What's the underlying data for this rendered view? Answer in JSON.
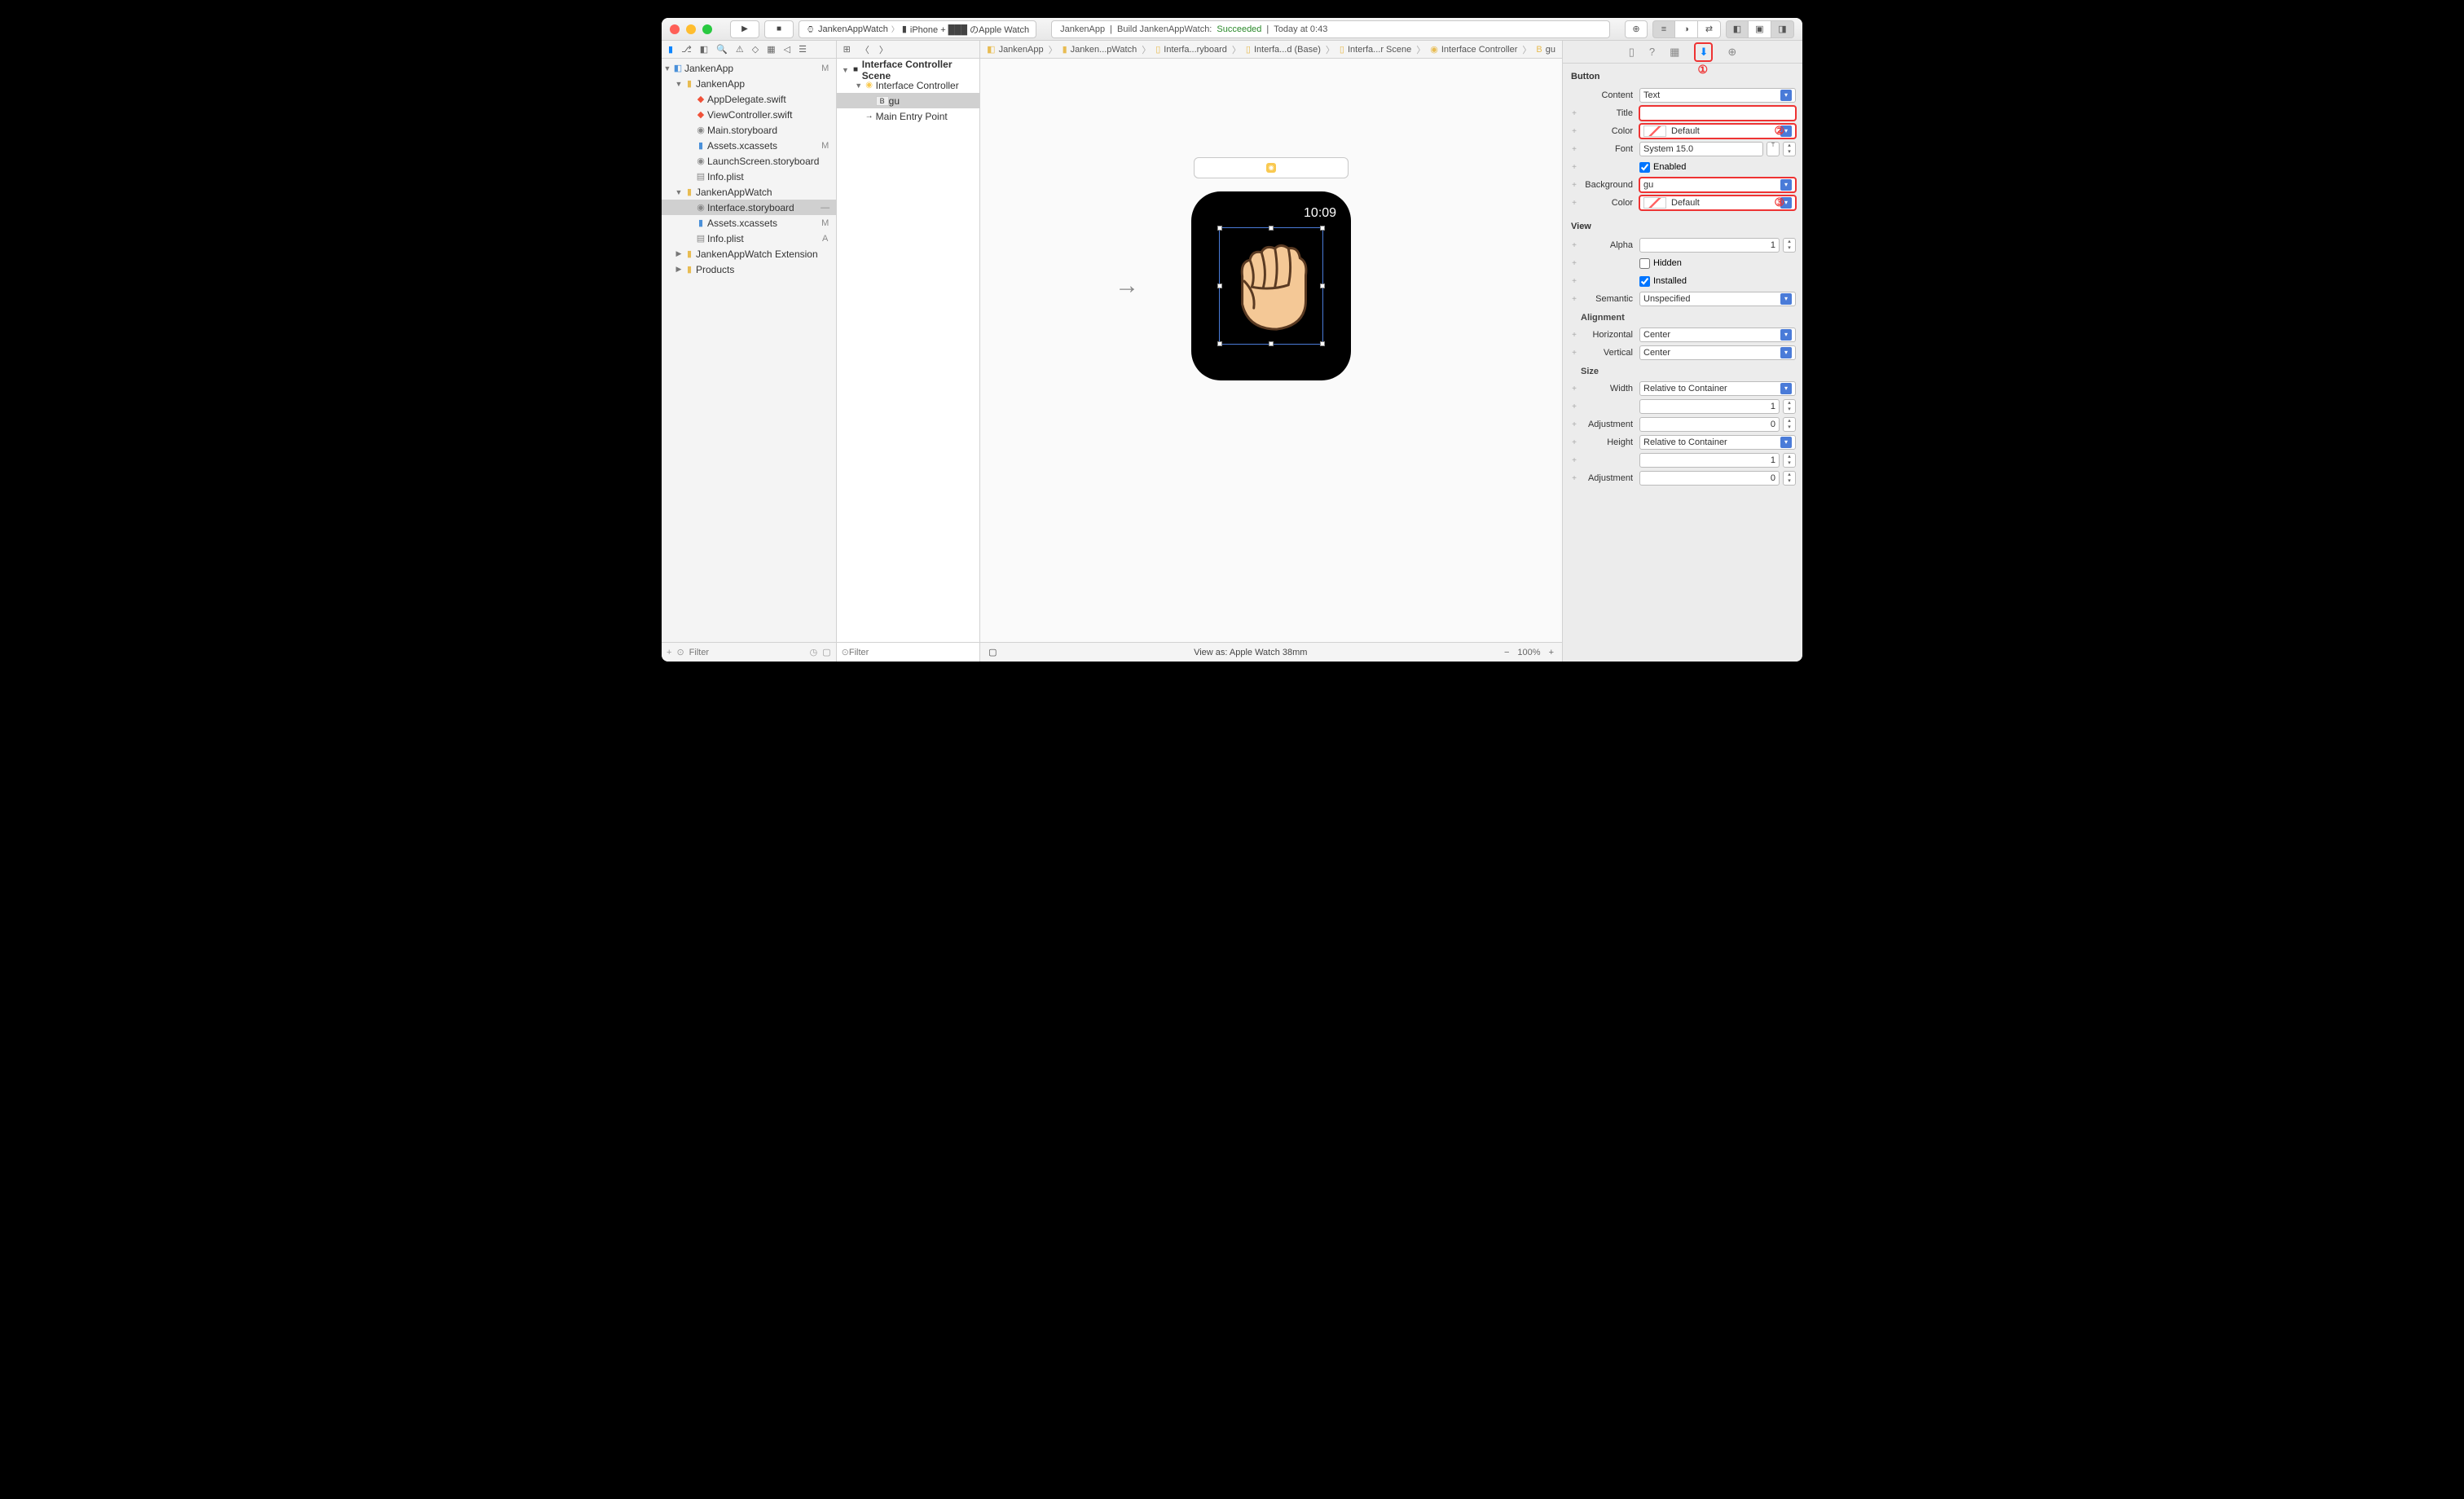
{
  "titlebar": {
    "scheme_target": "JankenAppWatch",
    "scheme_device": "iPhone + ███ のApple Watch",
    "status_app": "JankenApp",
    "status_text": "Build JankenAppWatch:",
    "status_result": "Succeeded",
    "status_time": "Today at 0:43"
  },
  "navigator": {
    "rows": [
      {
        "ind": 0,
        "disc": "▼",
        "icon": "◧",
        "iclass": "ic-proj",
        "label": "JankenApp",
        "status": "M"
      },
      {
        "ind": 1,
        "disc": "▼",
        "icon": "▮",
        "iclass": "ic-folder",
        "label": "JankenApp",
        "status": ""
      },
      {
        "ind": 2,
        "disc": "",
        "icon": "◆",
        "iclass": "ic-swift",
        "label": "AppDelegate.swift",
        "status": ""
      },
      {
        "ind": 2,
        "disc": "",
        "icon": "◆",
        "iclass": "ic-swift",
        "label": "ViewController.swift",
        "status": ""
      },
      {
        "ind": 2,
        "disc": "",
        "icon": "◉",
        "iclass": "ic-sb",
        "label": "Main.storyboard",
        "status": ""
      },
      {
        "ind": 2,
        "disc": "",
        "icon": "▮",
        "iclass": "ic-assets",
        "label": "Assets.xcassets",
        "status": "M"
      },
      {
        "ind": 2,
        "disc": "",
        "icon": "◉",
        "iclass": "ic-sb",
        "label": "LaunchScreen.storyboard",
        "status": ""
      },
      {
        "ind": 2,
        "disc": "",
        "icon": "▤",
        "iclass": "ic-plist",
        "label": "Info.plist",
        "status": ""
      },
      {
        "ind": 1,
        "disc": "▼",
        "icon": "▮",
        "iclass": "ic-folder",
        "label": "JankenAppWatch",
        "status": ""
      },
      {
        "ind": 2,
        "disc": "",
        "icon": "◉",
        "iclass": "ic-sb",
        "label": "Interface.storyboard",
        "status": "—",
        "selected": true
      },
      {
        "ind": 2,
        "disc": "",
        "icon": "▮",
        "iclass": "ic-assets",
        "label": "Assets.xcassets",
        "status": "M"
      },
      {
        "ind": 2,
        "disc": "",
        "icon": "▤",
        "iclass": "ic-plist",
        "label": "Info.plist",
        "status": "A"
      },
      {
        "ind": 1,
        "disc": "▶",
        "icon": "▮",
        "iclass": "ic-folder",
        "label": "JankenAppWatch Extension",
        "status": ""
      },
      {
        "ind": 1,
        "disc": "▶",
        "icon": "▮",
        "iclass": "ic-folder",
        "label": "Products",
        "status": ""
      }
    ],
    "filter_placeholder": "Filter"
  },
  "outline": {
    "rows": [
      {
        "ind": 0,
        "disc": "▼",
        "icon": "■",
        "iclass": "",
        "label": "Interface Controller Scene",
        "bold": true
      },
      {
        "ind": 1,
        "disc": "▼",
        "icon": "◉",
        "iclass": "",
        "label": "Interface Controller",
        "ystyle": "color:#f9c950"
      },
      {
        "ind": 2,
        "disc": "",
        "icon": "B",
        "iclass": "",
        "label": "gu",
        "selected": true,
        "ystyle": "background:#eee;border:1px solid #ccc;font-size:9px;padding:0 2px"
      },
      {
        "ind": 1,
        "disc": "",
        "icon": "→",
        "iclass": "",
        "label": "Main Entry Point"
      }
    ],
    "filter_placeholder": "Filter"
  },
  "breadcrumb": [
    "JankenApp",
    "Janken...pWatch",
    "Interfa...ryboard",
    "Interfa...d (Base)",
    "Interfa...r Scene",
    "Interface Controller",
    "gu"
  ],
  "canvas": {
    "watch_time": "10:09",
    "view_as": "View as: Apple Watch 38mm",
    "zoom": "100%"
  },
  "inspector": {
    "section_button": "Button",
    "content_label": "Content",
    "content_value": "Text",
    "title_label": "Title",
    "title_value": "",
    "color_label": "Color",
    "color_value": "Default",
    "font_label": "Font",
    "font_value": "System 15.0",
    "enabled_label": "Enabled",
    "background_label": "Background",
    "background_value": "gu",
    "color2_label": "Color",
    "color2_value": "Default",
    "section_view": "View",
    "alpha_label": "Alpha",
    "alpha_value": "1",
    "hidden_label": "Hidden",
    "installed_label": "Installed",
    "semantic_label": "Semantic",
    "semantic_value": "Unspecified",
    "section_alignment": "Alignment",
    "horiz_label": "Horizontal",
    "horiz_value": "Center",
    "vert_label": "Vertical",
    "vert_value": "Center",
    "section_size": "Size",
    "width_label": "Width",
    "width_value": "Relative to Container",
    "width_num": "1",
    "adj1_label": "Adjustment",
    "adj1_value": "0",
    "height_label": "Height",
    "height_value": "Relative to Container",
    "height_num": "1",
    "adj2_label": "Adjustment",
    "adj2_value": "0",
    "annotations": {
      "n1": "①",
      "n2": "②",
      "n3": "③"
    }
  }
}
